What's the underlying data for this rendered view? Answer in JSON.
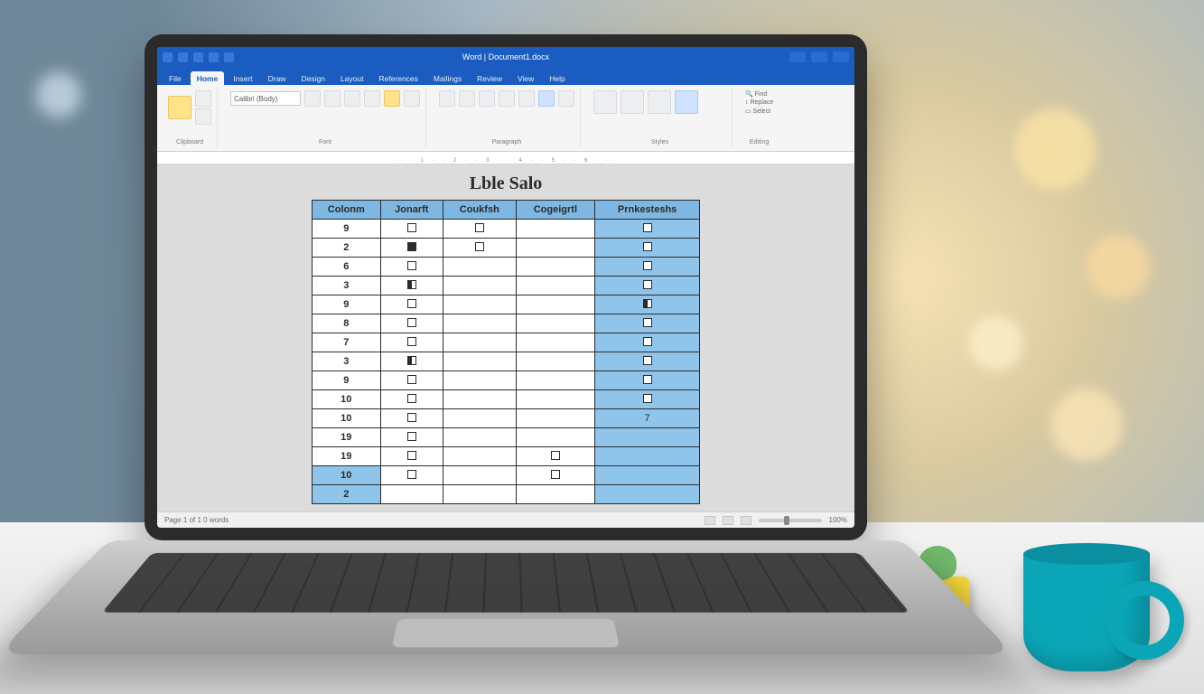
{
  "titlebar": {
    "title": "Word | Document1.docx"
  },
  "tabs": [
    {
      "label": "File"
    },
    {
      "label": "Home",
      "active": true
    },
    {
      "label": "Insert"
    },
    {
      "label": "Draw"
    },
    {
      "label": "Design"
    },
    {
      "label": "Layout"
    },
    {
      "label": "References"
    },
    {
      "label": "Mailings"
    },
    {
      "label": "Review"
    },
    {
      "label": "View"
    },
    {
      "label": "Help"
    }
  ],
  "ribbon_groups": {
    "clipboard": "Clipboard",
    "font": "Font",
    "paragraph": "Paragraph",
    "styles": "Styles",
    "editing": "Editing"
  },
  "font_box": "Calibri (Body)",
  "ruler_ticks": "· · 1 · · 2 · · 3 · · 4 · · 5 · · 6 · ·",
  "document": {
    "title": "Lble Salo",
    "headers": [
      "Colonm",
      "Jonarft",
      "Coukfsh",
      "Cogeigrtl",
      "Prnkesteshs"
    ],
    "rows": [
      {
        "n": "9",
        "c2": "mark",
        "c3": "mark",
        "c4": "",
        "c5": "mark"
      },
      {
        "n": "2",
        "c2": "fill",
        "c3": "mark",
        "c4": "",
        "c5": "mark"
      },
      {
        "n": "6",
        "c2": "mark",
        "c3": "",
        "c4": "",
        "c5": "mark"
      },
      {
        "n": "3",
        "c2": "half",
        "c3": "",
        "c4": "",
        "c5": "mark"
      },
      {
        "n": "9",
        "c2": "mark",
        "c3": "",
        "c4": "",
        "c5": "half"
      },
      {
        "n": "8",
        "c2": "mark",
        "c3": "",
        "c4": "",
        "c5": "mark"
      },
      {
        "n": "7",
        "c2": "mark",
        "c3": "",
        "c4": "",
        "c5": "mark"
      },
      {
        "n": "3",
        "c2": "half",
        "c3": "",
        "c4": "",
        "c5": "mark"
      },
      {
        "n": "9",
        "c2": "mark",
        "c3": "",
        "c4": "",
        "c5": "mark"
      },
      {
        "n": "10",
        "c2": "mark",
        "c3": "",
        "c4": "",
        "c5": "mark"
      },
      {
        "n": "10",
        "c2": "mark",
        "c3": "",
        "c4": "",
        "c5": "7"
      },
      {
        "n": "19",
        "c2": "mark",
        "c3": "",
        "c4": "",
        "c5": ""
      },
      {
        "n": "19",
        "c2": "mark",
        "c3": "",
        "c4": "mark",
        "c5": ""
      },
      {
        "n": "10",
        "c2": "mark",
        "c3": "",
        "c4": "mark",
        "c5": "",
        "hl": true
      },
      {
        "n": "2",
        "c2": "",
        "c3": "",
        "c4": "",
        "c5": "",
        "hl": true
      }
    ]
  },
  "statusbar": {
    "left": "Page 1 of 1    0 words",
    "zoom": "100%"
  }
}
